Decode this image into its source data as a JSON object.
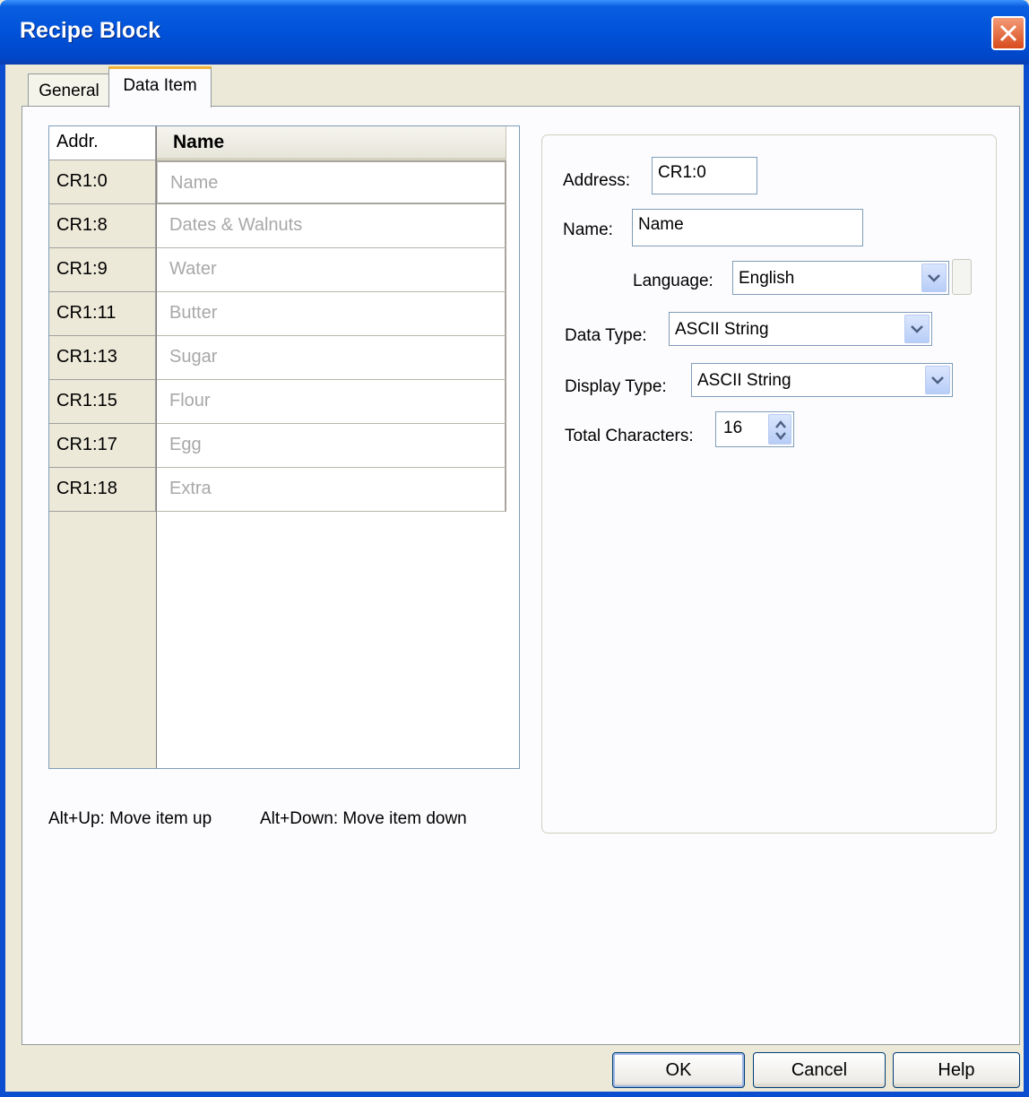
{
  "window": {
    "title": "Recipe Block"
  },
  "tabs": [
    {
      "label": "General"
    },
    {
      "label": "Data Item"
    }
  ],
  "table": {
    "headers": {
      "addr": "Addr.",
      "name": "Name"
    },
    "rows": [
      {
        "addr": "CR1:0",
        "name": "Name"
      },
      {
        "addr": "CR1:8",
        "name": "Dates & Walnuts"
      },
      {
        "addr": "CR1:9",
        "name": "Water"
      },
      {
        "addr": "CR1:11",
        "name": "Butter"
      },
      {
        "addr": "CR1:13",
        "name": "Sugar"
      },
      {
        "addr": "CR1:15",
        "name": "Flour"
      },
      {
        "addr": "CR1:17",
        "name": "Egg"
      },
      {
        "addr": "CR1:18",
        "name": "Extra"
      }
    ]
  },
  "hints": {
    "move_up": "Alt+Up: Move item up",
    "move_down": "Alt+Down: Move item down"
  },
  "properties": {
    "address_label": "Address:",
    "address_value": "CR1:0",
    "name_label": "Name:",
    "name_value": "Name",
    "language_label": "Language:",
    "language_value": "English",
    "data_type_label": "Data Type:",
    "data_type_value": "ASCII String",
    "display_type_label": "Display Type:",
    "display_type_value": "ASCII String",
    "total_chars_label": "Total Characters:",
    "total_chars_value": "16"
  },
  "buttons": {
    "ok": "OK",
    "cancel": "Cancel",
    "help": "Help"
  },
  "colors": {
    "titlebar": "#0052d9",
    "dialog_bg": "#ece9d8",
    "active_tab_accent": "#f3b23a"
  }
}
